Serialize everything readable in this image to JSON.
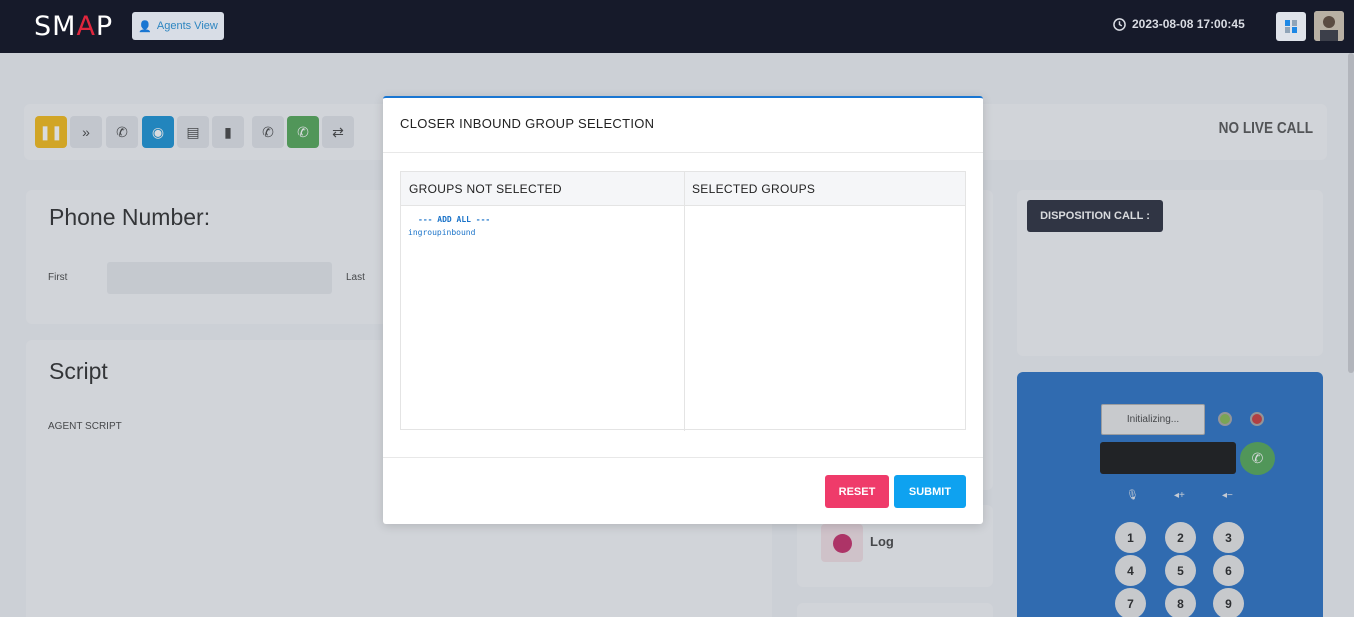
{
  "header": {
    "logo": {
      "prefix": "SM",
      "accent": "A",
      "suffix": "P"
    },
    "agents_view_label": "Agents View",
    "datetime": "2023-08-08 17:00:45"
  },
  "toolbar": {
    "status_text": "NO LIVE CALL",
    "buttons": [
      "pause-icon",
      "skip-icon",
      "hangup-icon",
      "record-icon",
      "form-icon",
      "document-icon",
      "dial-icon",
      "answer-icon",
      "transfer-icon"
    ]
  },
  "lead": {
    "title": "Phone Number:",
    "first_label": "First",
    "last_label": "Last"
  },
  "script": {
    "title": "Script",
    "body": "AGENT SCRIPT"
  },
  "disposition": {
    "label": "DISPOSITION CALL :"
  },
  "softphone": {
    "status": "Initializing...",
    "keys": [
      "1",
      "2",
      "3",
      "4",
      "5",
      "6",
      "7",
      "8",
      "9"
    ]
  },
  "log": {
    "label": "Log"
  },
  "modal": {
    "title": "CLOSER INBOUND GROUP SELECTION",
    "col_not_selected": "GROUPS NOT SELECTED",
    "col_selected": "SELECTED GROUPS",
    "add_all": "--- ADD ALL ---",
    "groups_not_selected": [
      "ingroupinbound"
    ],
    "reset_label": "RESET",
    "submit_label": "SUBMIT"
  },
  "colors": {
    "topbar": "#161a2a",
    "accent_blue": "#1565c0",
    "reset": "#ef3b6a",
    "submit": "#0ea2f0",
    "pause": "#f4b400",
    "record": "#0288d1",
    "answer": "#43a047"
  }
}
